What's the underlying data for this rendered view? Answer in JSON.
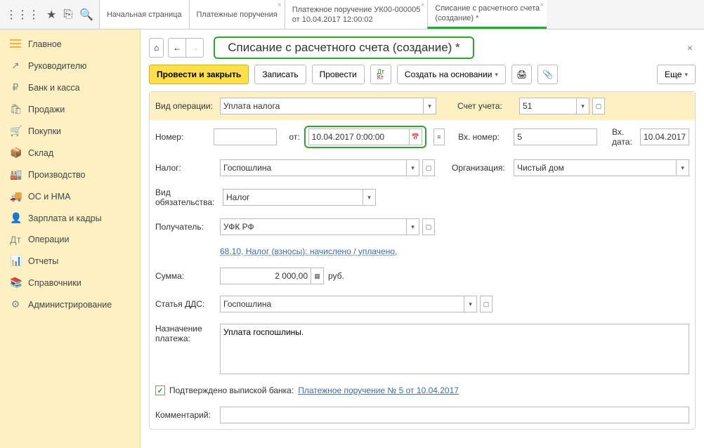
{
  "topIcons": {
    "apps": "⋮⋮⋮",
    "star": "★",
    "misc": "⎘",
    "search": "🔍"
  },
  "tabs": [
    {
      "line1": "Начальная страница",
      "line2": ""
    },
    {
      "line1": "Платежные поручения",
      "line2": "",
      "closable": true
    },
    {
      "line1": "Платежное поручение УК00-000005",
      "line2": "от 10.04.2017 12:00:02",
      "closable": true
    },
    {
      "line1": "Списание с расчетного счета",
      "line2": "(создание) *",
      "closable": true,
      "active": true
    }
  ],
  "sidebar": [
    {
      "icon": "burger",
      "label": "Главное"
    },
    {
      "icon": "↗",
      "label": "Руководителю"
    },
    {
      "icon": "₽",
      "label": "Банк и касса"
    },
    {
      "icon": "🛍",
      "label": "Продажи"
    },
    {
      "icon": "🛒",
      "label": "Покупки"
    },
    {
      "icon": "📦",
      "label": "Склад"
    },
    {
      "icon": "🏭",
      "label": "Производство"
    },
    {
      "icon": "🚚",
      "label": "ОС и НМА"
    },
    {
      "icon": "👤",
      "label": "Зарплата и кадры"
    },
    {
      "icon": "Дт",
      "label": "Операции"
    },
    {
      "icon": "📊",
      "label": "Отчеты"
    },
    {
      "icon": "📚",
      "label": "Справочники"
    },
    {
      "icon": "⚙",
      "label": "Администрирование"
    }
  ],
  "btn": {
    "home": "⌂",
    "back": "←",
    "fwd": "→",
    "postClose": "Провести и закрыть",
    "save": "Записать",
    "post": "Провести",
    "createFrom": "Создать на основании",
    "printer": "🖨",
    "attach": "📎",
    "more": "Еще"
  },
  "pageTitle": "Списание с расчетного счета (создание) *",
  "labels": {
    "opType": "Вид операции:",
    "account": "Счет учета:",
    "number": "Номер:",
    "ot": "от:",
    "incNum": "Вх. номер:",
    "incDate": "Вх. дата:",
    "tax": "Налог:",
    "org": "Организация:",
    "liability": "Вид обязательства:",
    "recipient": "Получатель:",
    "sum": "Сумма:",
    "rub": "руб.",
    "dds": "Статья ДДС:",
    "purpose": "Назначение платежа:",
    "confirmed": "Подтверждено выпиской банка:",
    "comment": "Комментарий:"
  },
  "values": {
    "opType": "Уплата налога",
    "account": "51",
    "number": "",
    "date": "10.04.2017  0:00:00",
    "incNum": "5",
    "incDate": "10.04.2017",
    "tax": "Госпошлина",
    "org": "Чистый дом",
    "liability": "Налог",
    "recipient": "УФК РФ",
    "taxLink": "68.10, Налог (взносы): начислено / уплачено,",
    "sum": "2 000,00",
    "dds": "Госпошлина",
    "purpose": "Уплата госпошлины.",
    "bankLink": "Платежное поручение № 5 от 10.04.2017",
    "comment": "",
    "checked": "✓"
  }
}
